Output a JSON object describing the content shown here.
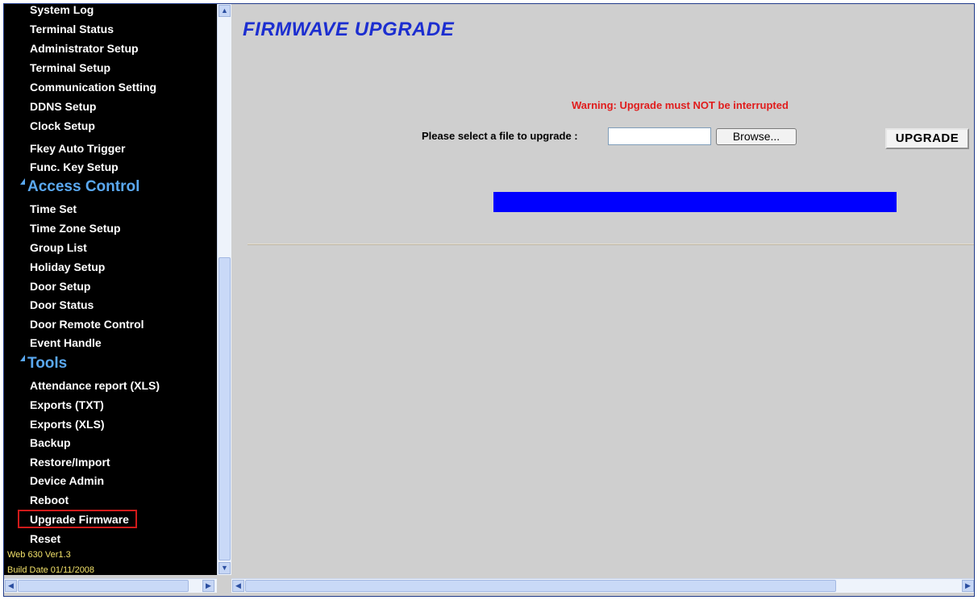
{
  "sidebar": {
    "items_top": [
      "System Log",
      "Terminal Status",
      "Administrator Setup",
      "Terminal Setup",
      "Communication Setting",
      "DDNS Setup",
      "Clock Setup",
      "Fkey Auto Trigger",
      "Func. Key Setup"
    ],
    "section_access": "Access Control",
    "items_access": [
      "Time Set",
      "Time Zone Setup",
      "Group List",
      "Holiday Setup",
      "Door Setup",
      "Door Status",
      "Door Remote Control",
      "Event Handle"
    ],
    "section_tools": "Tools",
    "items_tools": [
      "Attendance report (XLS)",
      "Exports (TXT)",
      "Exports (XLS)",
      "Backup",
      "Restore/Import",
      "Device Admin",
      "Reboot",
      "Upgrade Firmware",
      "Reset"
    ],
    "selected_item": "Upgrade Firmware",
    "version": "Web 630 Ver1.3",
    "build_date": "Build Date 01/11/2008"
  },
  "main": {
    "title": "FIRMWAVE UPGRADE",
    "warning": "Warning: Upgrade must NOT be interrupted",
    "file_label": "Please select a file to upgrade :",
    "file_value": "",
    "browse_label": "Browse...",
    "upgrade_label": "UPGRADE",
    "progress": 1.0
  },
  "icons": {
    "scroll_up": "chevron-up-icon",
    "scroll_down": "chevron-down-icon",
    "scroll_left": "chevron-left-icon",
    "scroll_right": "chevron-right-icon",
    "section_marker": "triangle-icon"
  },
  "colors": {
    "sidebar_bg": "#000000",
    "section_color": "#5aa8f0",
    "title_color": "#1c2ed0",
    "warning_color": "#e01c1c",
    "progress_color": "#0000ff",
    "selected_border": "#d01a1a",
    "version_color": "#f3e26a"
  }
}
